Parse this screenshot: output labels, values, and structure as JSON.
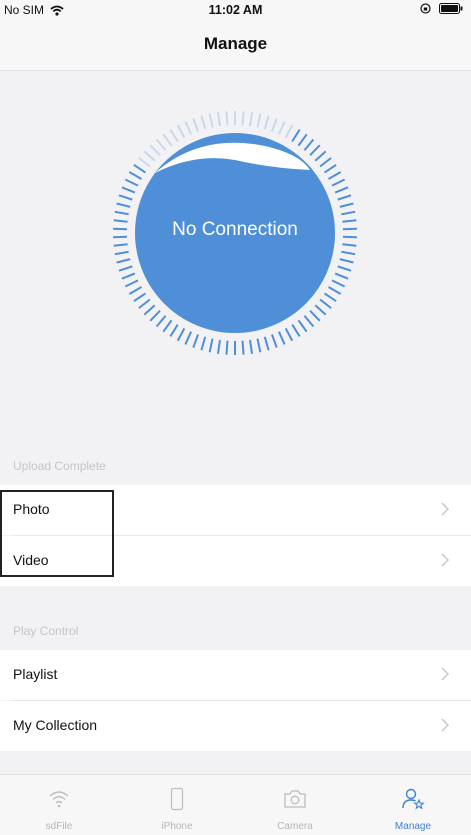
{
  "status_bar": {
    "carrier": "No SIM",
    "time": "11:02 AM"
  },
  "nav": {
    "title": "Manage"
  },
  "connection": {
    "status": "No Connection"
  },
  "upload_section": {
    "header": "Upload Complete",
    "items": [
      {
        "label": "Photo"
      },
      {
        "label": "Video"
      }
    ]
  },
  "play_section": {
    "header": "Play Control",
    "items": [
      {
        "label": "Playlist"
      },
      {
        "label": "My Collection"
      }
    ]
  },
  "tabs": [
    {
      "label": "sdFile",
      "icon": "wifi-icon"
    },
    {
      "label": "iPhone",
      "icon": "iphone-icon"
    },
    {
      "label": "Camera",
      "icon": "camera-icon"
    },
    {
      "label": "Manage",
      "icon": "manage-user-icon",
      "active": true
    }
  ],
  "colors": {
    "accent": "#3f7fd6",
    "dial_fill": "#4f8fd8",
    "background": "#f2f2f4"
  }
}
